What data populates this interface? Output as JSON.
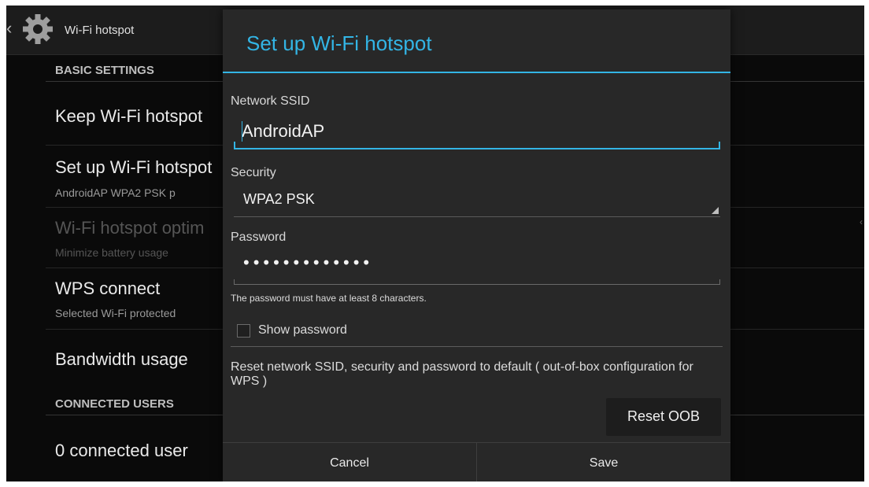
{
  "actionbar": {
    "back_glyph": "‹",
    "title": "Wi-Fi hotspot",
    "icon": "gear-icon"
  },
  "settings": {
    "section_basic": "BASIC SETTINGS",
    "keep_hotspot": {
      "title": "Keep Wi-Fi hotspot"
    },
    "setup_hotspot": {
      "title": "Set up Wi-Fi hotspot",
      "subtitle": "AndroidAP WPA2 PSK p"
    },
    "optimization": {
      "title": "Wi-Fi hotspot optim",
      "subtitle": "Minimize battery usage"
    },
    "wps_connect": {
      "title": "WPS connect",
      "subtitle": "Selected Wi-Fi protected"
    },
    "bandwidth": {
      "title": "Bandwidth usage"
    },
    "section_users": "CONNECTED USERS",
    "connected_users": {
      "title": "0 connected user"
    }
  },
  "dialog": {
    "title": "Set up Wi-Fi hotspot",
    "ssid_label": "Network SSID",
    "ssid_value": "AndroidAP",
    "security_label": "Security",
    "security_value": "WPA2 PSK",
    "password_label": "Password",
    "password_value": "•••••••••••••",
    "password_hint": "The password must have at least 8 characters.",
    "show_password_label": "Show password",
    "show_password_checked": false,
    "reset_text": "Reset network SSID, security and password to default ( out-of-box configuration for WPS )",
    "reset_button": "Reset OOB",
    "cancel_button": "Cancel",
    "save_button": "Save"
  },
  "colors": {
    "accent": "#33b5e5",
    "dialog_bg": "#282828",
    "screen_bg": "#0a0a0a"
  }
}
